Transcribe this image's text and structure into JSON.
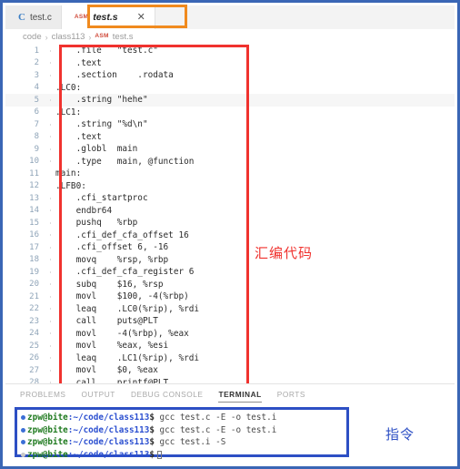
{
  "window": {
    "frame_color": "#3a66b5"
  },
  "tabs": [
    {
      "label": "test.c",
      "icon": "c-file-icon",
      "icon_text": "C",
      "active": false,
      "closable": false
    },
    {
      "label": "test.s",
      "icon": "asm-file-icon",
      "icon_text": "ASM",
      "active": true,
      "closable": true,
      "close_label": "✕"
    }
  ],
  "breadcrumb": {
    "items": [
      "code",
      "class113",
      "test.s"
    ],
    "separator": "›",
    "file_icon_text": "ASM"
  },
  "editor": {
    "highlight_box_color": "#f0322e",
    "active_line": 5,
    "lines": [
      {
        "n": "1",
        "text": "    .file   \"test.c\"",
        "guide": true
      },
      {
        "n": "2",
        "text": "    .text",
        "guide": true
      },
      {
        "n": "3",
        "text": "    .section    .rodata",
        "guide": true
      },
      {
        "n": "4",
        "text": ".LC0:",
        "guide": false
      },
      {
        "n": "5",
        "text": "    .string \"hehe\"",
        "guide": true
      },
      {
        "n": "6",
        "text": ".LC1:",
        "guide": false
      },
      {
        "n": "7",
        "text": "    .string \"%d\\n\"",
        "guide": true
      },
      {
        "n": "8",
        "text": "    .text",
        "guide": true
      },
      {
        "n": "9",
        "text": "    .globl  main",
        "guide": true
      },
      {
        "n": "10",
        "text": "    .type   main, @function",
        "guide": true
      },
      {
        "n": "11",
        "text": "main:",
        "guide": false
      },
      {
        "n": "12",
        "text": ".LFB0:",
        "guide": false
      },
      {
        "n": "13",
        "text": "    .cfi_startproc",
        "guide": true
      },
      {
        "n": "14",
        "text": "    endbr64",
        "guide": true
      },
      {
        "n": "15",
        "text": "    pushq   %rbp",
        "guide": true
      },
      {
        "n": "16",
        "text": "    .cfi_def_cfa_offset 16",
        "guide": true
      },
      {
        "n": "17",
        "text": "    .cfi_offset 6, -16",
        "guide": true
      },
      {
        "n": "18",
        "text": "    movq    %rsp, %rbp",
        "guide": true
      },
      {
        "n": "19",
        "text": "    .cfi_def_cfa_register 6",
        "guide": true
      },
      {
        "n": "20",
        "text": "    subq    $16, %rsp",
        "guide": true
      },
      {
        "n": "21",
        "text": "    movl    $100, -4(%rbp)",
        "guide": true
      },
      {
        "n": "22",
        "text": "    leaq    .LC0(%rip), %rdi",
        "guide": true
      },
      {
        "n": "23",
        "text": "    call    puts@PLT",
        "guide": true
      },
      {
        "n": "24",
        "text": "    movl    -4(%rbp), %eax",
        "guide": true
      },
      {
        "n": "25",
        "text": "    movl    %eax, %esi",
        "guide": true
      },
      {
        "n": "26",
        "text": "    leaq    .LC1(%rip), %rdi",
        "guide": true
      },
      {
        "n": "27",
        "text": "    movl    $0, %eax",
        "guide": true
      },
      {
        "n": "28",
        "text": "    call    printf@PLT",
        "guide": true
      }
    ]
  },
  "annotations": {
    "assembly_code": "汇编代码",
    "assembly_code_color": "#f0322e",
    "commands": "指令",
    "commands_color": "#2d4fc4"
  },
  "panel": {
    "tabs": [
      {
        "label": "PROBLEMS",
        "active": false
      },
      {
        "label": "OUTPUT",
        "active": false
      },
      {
        "label": "DEBUG CONSOLE",
        "active": false
      },
      {
        "label": "TERMINAL",
        "active": true
      },
      {
        "label": "PORTS",
        "active": false
      }
    ],
    "terminal": {
      "border_color": "#2d4fc4",
      "lines": [
        {
          "user": "zpw@bite",
          "path": ":~/code/class113",
          "prompt": "$",
          "command": " gcc test.c -E -o test.i",
          "marker": true,
          "cursor": false
        },
        {
          "user": "zpw@bite",
          "path": ":~/code/class113",
          "prompt": "$",
          "command": " gcc test.c -E -o test.i",
          "marker": true,
          "cursor": false
        },
        {
          "user": "zpw@bite",
          "path": ":~/code/class113",
          "prompt": "$",
          "command": " gcc test.i -S",
          "marker": true,
          "cursor": false
        },
        {
          "user": "zpw@bite",
          "path": ":~/code/class113",
          "prompt": "$",
          "command": "",
          "marker": false,
          "cursor": true
        }
      ]
    }
  }
}
